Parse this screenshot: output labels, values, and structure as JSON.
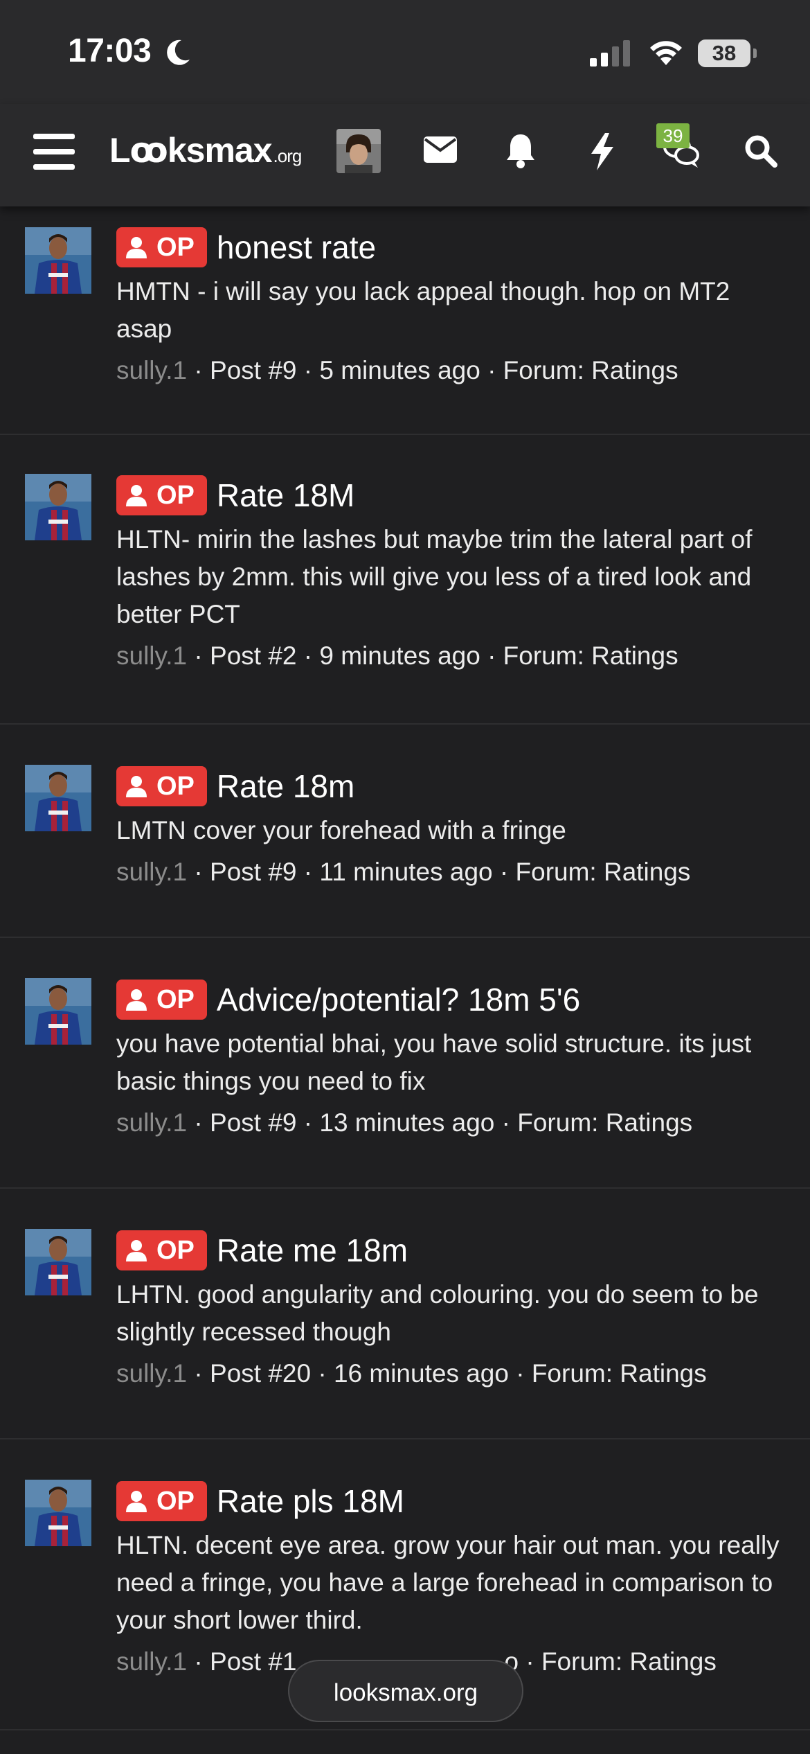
{
  "status": {
    "time": "17:03",
    "battery": "38",
    "battery_level": 0.38
  },
  "nav": {
    "logo_main": "Lꝏksmax",
    "logo_suffix": ".org",
    "chat_badge": "39",
    "icons": [
      "menu-icon",
      "mail-icon",
      "bell-icon",
      "bolt-icon",
      "chat-icon",
      "search-icon"
    ]
  },
  "colors": {
    "op_badge": "#e53935",
    "chat_badge": "#7cb342",
    "background": "#1f1f21",
    "header": "#2a2a2c"
  },
  "feed": [
    {
      "badge": "OP",
      "title": "honest rate",
      "snippet": "HMTN - i will say you lack appeal though. hop on MT2 asap",
      "user": "sully.1",
      "meta": " · Post #9 · 5 minutes ago · Forum: Ratings"
    },
    {
      "badge": "OP",
      "title": "Rate 18M",
      "snippet": "HLTN- mirin the lashes but maybe trim the lateral part of lashes by 2mm. this will give you less of a tired look and better PCT",
      "user": "sully.1",
      "meta": " · Post #2 · 9 minutes ago · Forum: Ratings"
    },
    {
      "badge": "OP",
      "title": "Rate 18m",
      "snippet": "LMTN cover your forehead with a fringe",
      "user": "sully.1",
      "meta": " · Post #9 · 11 minutes ago · Forum: Ratings"
    },
    {
      "badge": "OP",
      "title": "Advice/potential? 18m 5'6",
      "snippet": "you have potential bhai, you have solid structure. its just basic things you need to fix",
      "user": "sully.1",
      "meta": " · Post #9 · 13 minutes ago · Forum: Ratings"
    },
    {
      "badge": "OP",
      "title": "Rate me 18m",
      "snippet": "LHTN. good angularity and colouring. you do seem to be slightly recessed though",
      "user": "sully.1",
      "meta": " · Post #20 · 16 minutes ago · Forum: Ratings"
    },
    {
      "badge": "OP",
      "title": "Rate pls 18M",
      "snippet": "HLTN. decent eye area. grow your hair out man. you really need a fringe, you have a large forehead in comparison to your short lower third.",
      "user": "sully.1",
      "meta": " · Post #1",
      "meta_tail": "o · Forum: Ratings"
    }
  ],
  "browser": {
    "url": "looksmax.org"
  }
}
